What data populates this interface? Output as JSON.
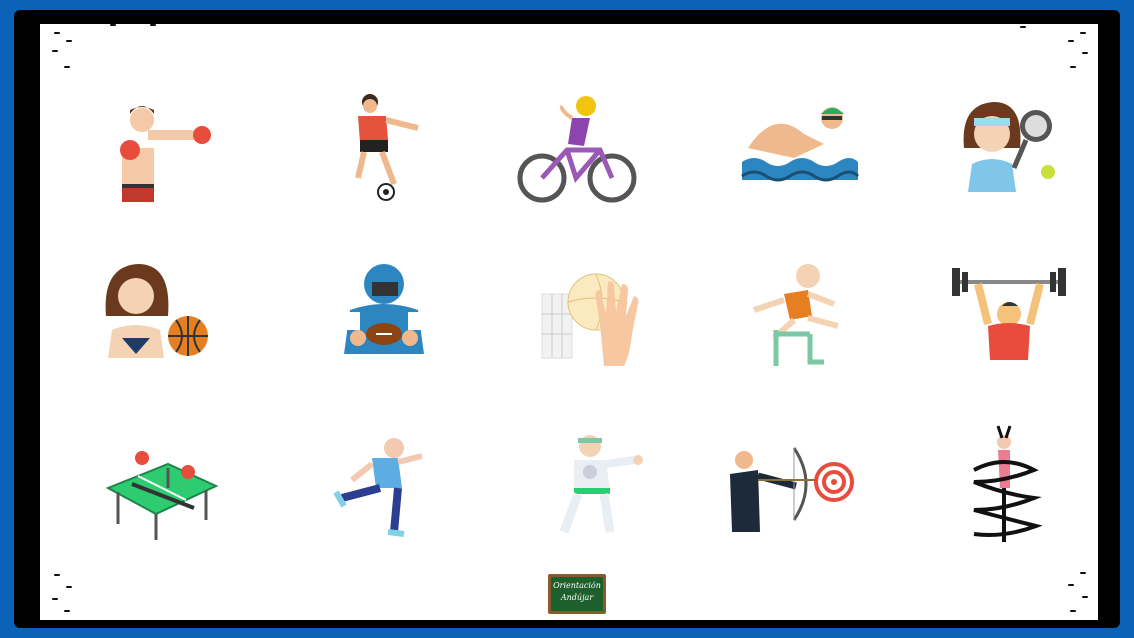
{
  "logo": {
    "line1": "Orientación",
    "line2": "Andújar"
  },
  "icons": [
    "boxing-icon",
    "soccer-icon",
    "cycling-icon",
    "swimming-icon",
    "tennis-icon",
    "basketball-icon",
    "american-football-icon",
    "volleyball-icon",
    "hurdles-icon",
    "weightlifting-icon",
    "table-tennis-icon",
    "running-icon",
    "karate-icon",
    "archery-icon",
    "rhythmic-gymnastics-icon"
  ]
}
